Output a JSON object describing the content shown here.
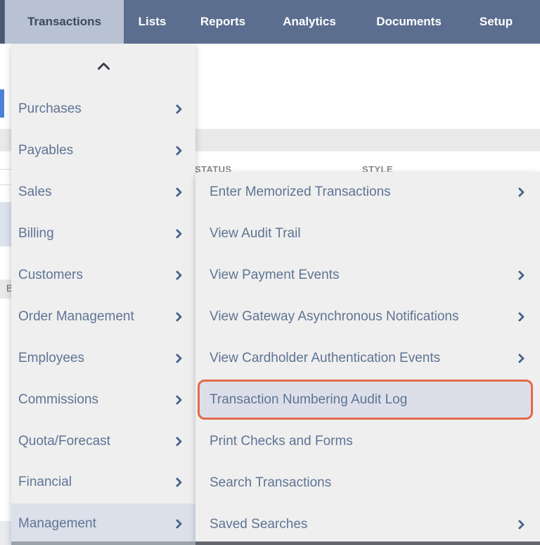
{
  "nav": {
    "tabs": [
      {
        "label": "Transactions",
        "active": true
      },
      {
        "label": "Lists",
        "active": false
      },
      {
        "label": "Reports",
        "active": false
      },
      {
        "label": "Analytics",
        "active": false
      },
      {
        "label": "Documents",
        "active": false
      },
      {
        "label": "Setup",
        "active": false
      }
    ]
  },
  "background": {
    "column_headers": {
      "status": "STATUS",
      "style": "STYLE"
    },
    "partial_letter": "B"
  },
  "transactions_menu": {
    "scroll_up_icon": "chevron-up-icon",
    "items": [
      {
        "label": "Purchases",
        "has_submenu": true
      },
      {
        "label": "Payables",
        "has_submenu": true
      },
      {
        "label": "Sales",
        "has_submenu": true
      },
      {
        "label": "Billing",
        "has_submenu": true
      },
      {
        "label": "Customers",
        "has_submenu": true
      },
      {
        "label": "Order Management",
        "has_submenu": true
      },
      {
        "label": "Employees",
        "has_submenu": true
      },
      {
        "label": "Commissions",
        "has_submenu": true
      },
      {
        "label": "Quota/Forecast",
        "has_submenu": true
      },
      {
        "label": "Financial",
        "has_submenu": true
      },
      {
        "label": "Management",
        "has_submenu": true,
        "active": true
      }
    ]
  },
  "management_submenu": {
    "items": [
      {
        "label": "Enter Memorized Transactions",
        "has_submenu": true
      },
      {
        "label": "View Audit Trail",
        "has_submenu": false
      },
      {
        "label": "View Payment Events",
        "has_submenu": true
      },
      {
        "label": "View Gateway Asynchronous Notifications",
        "has_submenu": true
      },
      {
        "label": "View Cardholder Authentication Events",
        "has_submenu": true
      },
      {
        "label": "Transaction Numbering Audit Log",
        "has_submenu": false,
        "highlighted": true
      },
      {
        "label": "Print Checks and Forms",
        "has_submenu": false
      },
      {
        "label": "Search Transactions",
        "has_submenu": false
      },
      {
        "label": "Saved Searches",
        "has_submenu": true
      }
    ]
  },
  "colors": {
    "nav_bg": "#5b6e90",
    "nav_active_tab_bg": "#b9c2d2",
    "nav_active_tab_text": "#3b4a61",
    "menu_bg": "#efefef",
    "menu_text": "#5e7494",
    "chevron": "#44618c",
    "active_row_bg": "#dce0ea",
    "highlight_bg": "#dcdfe9",
    "highlight_border": "#e56a4b"
  }
}
